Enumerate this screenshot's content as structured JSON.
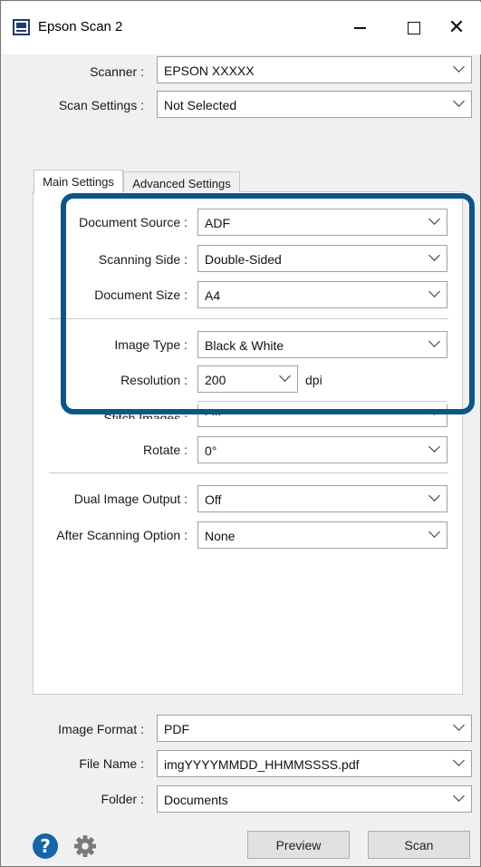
{
  "window": {
    "title": "Epson Scan 2"
  },
  "top": {
    "scanner_label": "Scanner :",
    "scanner_value": "EPSON XXXXX",
    "scan_settings_label": "Scan Settings :",
    "scan_settings_value": "Not Selected"
  },
  "tabs": [
    {
      "label": "Main Settings",
      "active": true
    },
    {
      "label": "Advanced Settings",
      "active": false
    }
  ],
  "main": {
    "document_source": {
      "label": "Document Source :",
      "value": "ADF"
    },
    "scanning_side": {
      "label": "Scanning Side :",
      "value": "Double-Sided"
    },
    "document_size": {
      "label": "Document Size :",
      "value": "A4"
    },
    "image_type": {
      "label": "Image Type :",
      "value": "Black & White"
    },
    "resolution": {
      "label": "Resolution :",
      "value": "200",
      "unit": "dpi"
    },
    "stitch_images": {
      "label": "Stitch Images :",
      "value": "Off"
    },
    "rotate": {
      "label": "Rotate :",
      "value": "0°"
    },
    "dual_image_output": {
      "label": "Dual Image Output :",
      "value": "Off"
    },
    "after_scanning": {
      "label": "After Scanning Option :",
      "value": "None"
    }
  },
  "bottom": {
    "image_format": {
      "label": "Image Format :",
      "value": "PDF"
    },
    "file_name": {
      "label": "File Name :",
      "value": "imgYYYYMMDD_HHMMSSSS.pdf"
    },
    "folder": {
      "label": "Folder :",
      "value": "Documents"
    }
  },
  "buttons": {
    "preview": "Preview",
    "scan": "Scan"
  },
  "icons": {
    "help": "?",
    "settings": "gear-icon",
    "close": "✕"
  },
  "colors": {
    "highlight": "#0a5688",
    "help": "#1565a8"
  }
}
